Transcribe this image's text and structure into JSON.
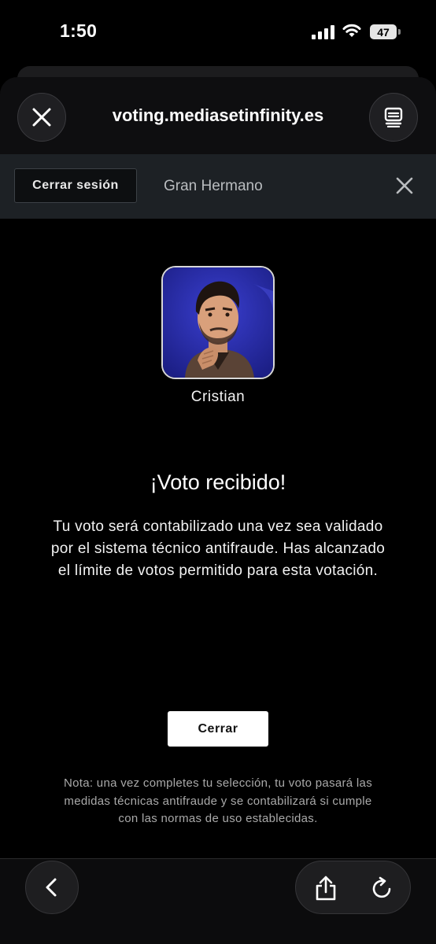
{
  "status_bar": {
    "time": "1:50",
    "battery_level": "47",
    "icons": [
      "signal-icon",
      "wifi-icon",
      "battery-icon"
    ]
  },
  "browser": {
    "url": "voting.mediasetinfinity.es",
    "close_icon": "close-icon",
    "tabs_icon": "tabs-icon"
  },
  "site_header": {
    "logout_label": "Cerrar sesión",
    "title": "Gran Hermano",
    "close_icon": "close-icon"
  },
  "candidate": {
    "name": "Cristian",
    "photo_background": "#2b2fa8"
  },
  "confirmation": {
    "headline": "¡Voto recibido!",
    "message": "Tu voto será contabilizado una vez sea validado por el sistema técnico antifraude. Has alcanzado el límite de votos permitido para esta votación.",
    "close_button_label": "Cerrar",
    "note": "Nota: una vez completes tu selección, tu voto pasará las medidas técnicas antifraude y se contabilizará si cumple con las normas de uso establecidas."
  },
  "toolbar": {
    "back_icon": "chevron-left-icon",
    "share_icon": "share-icon",
    "reload_icon": "reload-icon"
  },
  "colors": {
    "page_background": "#000000",
    "site_bar_background": "#1d2125",
    "button_background": "#ffffff",
    "note_text": "#a9a9a9"
  }
}
